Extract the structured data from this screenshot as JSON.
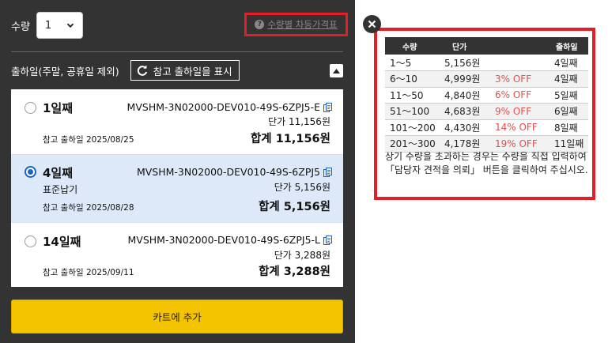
{
  "quantity": {
    "label": "수량",
    "selected": "1",
    "price_link": "수량별 차등가격표"
  },
  "shipping": {
    "label": "출하일(주말, 공휴일 제외)",
    "ref_button": "참고 출하일을 표시"
  },
  "options": [
    {
      "day": "1일째",
      "sub": "",
      "sku": "MVSHM-3N02000-DEV010-49S-6ZPJ5-E",
      "unit_price": "단가 11,156원",
      "ref_date": "참고 출하일  2025/08/25",
      "total": "합계 11,156원",
      "selected": false
    },
    {
      "day": "4일째",
      "sub": "표준납기",
      "sku": "MVSHM-3N02000-DEV010-49S-6ZPJ5",
      "unit_price": "단가 5,156원",
      "ref_date": "참고 출하일  2025/08/28",
      "total": "합계 5,156원",
      "selected": true
    },
    {
      "day": "14일째",
      "sub": "",
      "sku": "MVSHM-3N02000-DEV010-49S-6ZPJ5-L",
      "unit_price": "단가 3,288원",
      "ref_date": "참고 출하일  2025/09/11",
      "total": "합계 3,288원",
      "selected": false
    }
  ],
  "cart_button": "카트에 추가",
  "price_table": {
    "headers": [
      "수량",
      "단가",
      "",
      "출하일"
    ],
    "rows": [
      [
        "1～5",
        "5,156원",
        "",
        "4일째"
      ],
      [
        "6～10",
        "4,999원",
        "3% OFF",
        "4일째"
      ],
      [
        "11～50",
        "4,840원",
        "6% OFF",
        "5일째"
      ],
      [
        "51～100",
        "4,683원",
        "9% OFF",
        "6일째"
      ],
      [
        "101～200",
        "4,430원",
        "14% OFF",
        "8일째"
      ],
      [
        "201～300",
        "4,178원",
        "19% OFF",
        "11일째"
      ]
    ],
    "note": "상기 수량을 초과하는 경우는 수량을 직접 입력하여 「담당자 견적을 의뢰」 버튼을 클릭하여 주십시오."
  },
  "colors": {
    "panel_bg": "#333333",
    "highlight_border": "#e41e26",
    "selected_bg": "#dde9f8",
    "radio_accent": "#1a64c8",
    "cart_button_bg": "#f5c400",
    "discount_text": "#e05050"
  }
}
